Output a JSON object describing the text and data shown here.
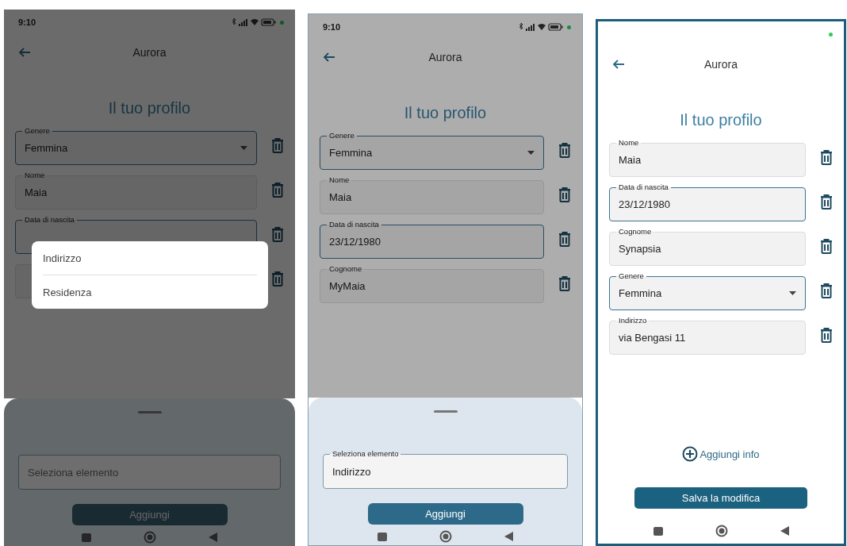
{
  "screens": [
    {
      "status_bar": {
        "time": "9:10"
      },
      "header": {
        "title": "Aurora"
      },
      "heading": "Il tuo profilo",
      "fields": [
        {
          "kind": "dropdown",
          "label": "Genere",
          "value": "Femmina",
          "focused": true
        },
        {
          "kind": "text",
          "label": "Nome",
          "value": "Maia",
          "focused": false
        },
        {
          "kind": "text",
          "label": "Data di nascita",
          "focused": true
        },
        {
          "kind": "text",
          "focused": false
        }
      ],
      "dimmed": true,
      "menu": {
        "items": [
          {
            "label": "Indirizzo"
          },
          {
            "label": "Residenza"
          }
        ]
      },
      "sheet": {
        "dimmed": true,
        "field": {
          "placeholder": "Seleziona elemento"
        },
        "button": {
          "label": "Aggiungi",
          "disabled": true
        }
      }
    },
    {
      "status_bar": {
        "time": "9:10"
      },
      "header": {
        "title": "Aurora"
      },
      "heading": "Il tuo profilo",
      "fields": [
        {
          "kind": "dropdown",
          "label": "Genere",
          "value": "Femmina",
          "focused": true
        },
        {
          "kind": "text",
          "label": "Nome",
          "value": "Maia",
          "focused": false
        },
        {
          "kind": "text",
          "label": "Data di nascita",
          "value": "23/12/1980",
          "focused": true
        },
        {
          "kind": "text",
          "label": "Cognome",
          "value": "MyMaia",
          "focused": false
        }
      ],
      "dimmed": true,
      "sheet": {
        "dimmed": false,
        "field": {
          "label": "Seleziona elemento",
          "value": "Indirizzo"
        },
        "button": {
          "label": "Aggiungi",
          "disabled": false
        }
      }
    },
    {
      "dimmed": false,
      "header": {
        "title": "Aurora"
      },
      "heading": "Il tuo profilo",
      "fields": [
        {
          "kind": "text",
          "label": "Nome",
          "value": "Maia",
          "focused": false
        },
        {
          "kind": "text",
          "label": "Data di nascita",
          "value": "23/12/1980",
          "focused": true
        },
        {
          "kind": "text",
          "label": "Cognome",
          "value": "Synapsia",
          "focused": false
        },
        {
          "kind": "dropdown",
          "label": "Genere",
          "value": "Femmina",
          "focused": true
        },
        {
          "kind": "text",
          "label": "Indirizzo",
          "value": "via Bengasi 11",
          "focused": false
        }
      ],
      "add_info": "Aggiungi info",
      "save_button": "Salva la modifica"
    }
  ]
}
